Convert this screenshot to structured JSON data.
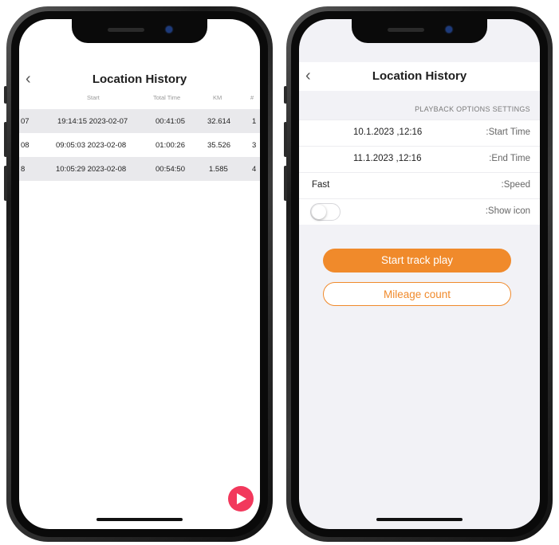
{
  "left_screen": {
    "title": "Location History",
    "headers": {
      "start": "Start",
      "total_time": "Total Time",
      "km": "KM",
      "index": "#"
    },
    "rows": [
      {
        "partial": "07",
        "start": "19:14:15 2023-02-07",
        "total_time": "00:41:05",
        "km": "32.614",
        "index": "1"
      },
      {
        "partial": "08",
        "start": "09:05:03 2023-02-08",
        "total_time": "01:00:26",
        "km": "35.526",
        "index": "3"
      },
      {
        "partial": "8",
        "start": "10:05:29 2023-02-08",
        "total_time": "00:54:50",
        "km": "1.585",
        "index": "4"
      }
    ],
    "fab_icon": "play-icon"
  },
  "right_screen": {
    "title": "Location History",
    "section_header": "PLAYBACK OPTIONS SETTINGS",
    "options": {
      "start_time": {
        "label": ":Start Time",
        "value": "10.1.2023 ,12:16"
      },
      "end_time": {
        "label": ":End Time",
        "value": "11.1.2023 ,12:16"
      },
      "speed": {
        "label": ":Speed",
        "value": "Fast"
      },
      "show_icon": {
        "label": ":Show icon",
        "enabled": false
      }
    },
    "buttons": {
      "start_track_play": "Start track play",
      "mileage_count": "Mileage count"
    }
  },
  "colors": {
    "accent": "#f08a2b",
    "fab": "#f2385c",
    "section_bg": "#f2f2f6",
    "row_shade": "#e9e9ec"
  }
}
